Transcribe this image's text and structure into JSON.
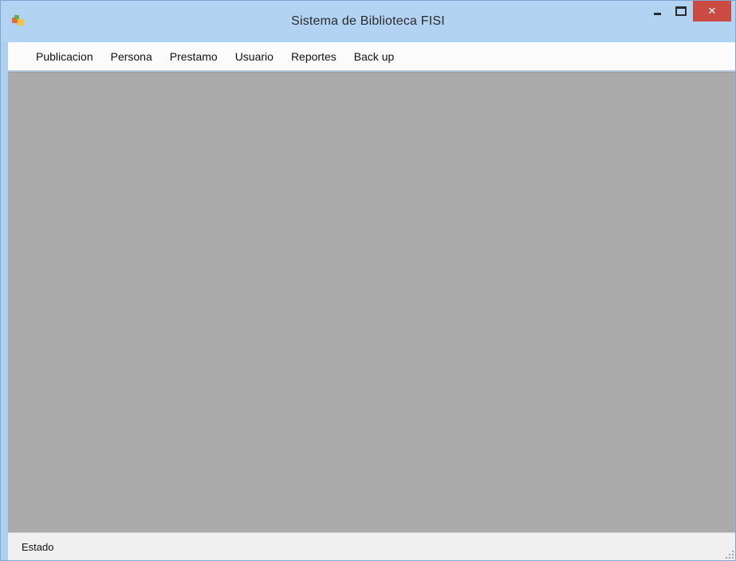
{
  "window": {
    "title": "Sistema de Biblioteca FISI",
    "app_icon": "app-icon",
    "controls": {
      "minimize_icon": "minimize-icon",
      "maximize_icon": "maximize-icon",
      "close_icon": "close-icon",
      "close_glyph": "✕"
    }
  },
  "menu": {
    "items": [
      {
        "label": "Publicacion"
      },
      {
        "label": "Persona"
      },
      {
        "label": "Prestamo"
      },
      {
        "label": "Usuario"
      },
      {
        "label": "Reportes"
      },
      {
        "label": "Back up"
      }
    ]
  },
  "status": {
    "label": "Estado"
  },
  "colors": {
    "titlebar": "#b2d3f1",
    "close_button": "#c94b42",
    "client_area": "#ababab",
    "menubar": "#fbfbfb"
  }
}
